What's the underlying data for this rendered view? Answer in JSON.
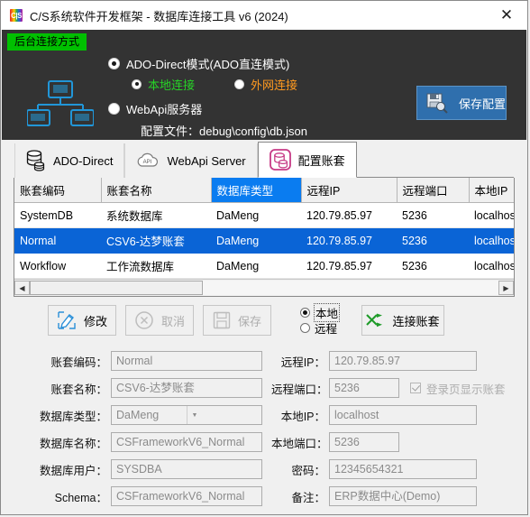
{
  "window": {
    "title": "C/S系统软件开发框架 - 数据库连接工具 v6 (2024)",
    "app_icon": "cis-logo-icon",
    "close_label": "✕"
  },
  "connection_panel": {
    "badge": "后台连接方式",
    "network_icon": "network-diagram-icon",
    "mode_primary": {
      "label": "ADO-Direct模式(ADO直连模式)",
      "selected": true
    },
    "sub_options": [
      {
        "label": "本地连接",
        "selected": true,
        "color": "#27d327"
      },
      {
        "label": "外网连接",
        "selected": false,
        "color": "#ff9a20"
      }
    ],
    "mode_webapi": {
      "label": "WebApi服务器",
      "selected": false
    },
    "config_file_line": "配置文件：debug\\config\\db.json",
    "save_button": {
      "label": "保存配置",
      "icon": "save-config-icon",
      "background": "#2f6fad"
    }
  },
  "tabs": [
    {
      "label": "ADO-Direct",
      "icon": "database-icon",
      "active": false
    },
    {
      "label": "WebApi Server",
      "icon": "api-cloud-icon",
      "active": false
    },
    {
      "label": "配置账套",
      "icon": "database-pink-icon",
      "active": true
    }
  ],
  "grid": {
    "columns": [
      {
        "label": "账套编码",
        "selected": false
      },
      {
        "label": "账套名称",
        "selected": false
      },
      {
        "label": "数据库类型",
        "selected": true
      },
      {
        "label": "远程IP",
        "selected": false
      },
      {
        "label": "远程端口",
        "selected": false
      },
      {
        "label": "本地IP",
        "selected": false
      }
    ],
    "rows": [
      {
        "cells": [
          "SystemDB",
          "系统数据库",
          "DaMeng",
          "120.79.85.97",
          "5236",
          "localhost"
        ],
        "selected": false
      },
      {
        "cells": [
          "Normal",
          "CSV6-达梦账套",
          "DaMeng",
          "120.79.85.97",
          "5236",
          "localhost"
        ],
        "selected": true
      },
      {
        "cells": [
          "Workflow",
          "工作流数据库",
          "DaMeng",
          "120.79.85.97",
          "5236",
          "localhost"
        ],
        "selected": false
      }
    ],
    "selection_color": "#0a64d6",
    "header_selection_color": "#0a7cf0",
    "scroll_left_arrow": "◀",
    "scroll_right_arrow": "▶"
  },
  "toolbar": {
    "edit_button": {
      "label": "修改",
      "icon": "edit-pencil-icon",
      "disabled": false
    },
    "cancel_button": {
      "label": "取消",
      "icon": "cancel-circle-icon",
      "disabled": true
    },
    "save_button": {
      "label": "保存",
      "icon": "floppy-save-icon",
      "disabled": true
    },
    "scope_options": [
      {
        "label": "本地",
        "selected": true
      },
      {
        "label": "远程",
        "selected": false
      }
    ],
    "connect_button": {
      "label": "连接账套",
      "icon": "shuffle-arrows-icon"
    }
  },
  "form": {
    "left": [
      {
        "label": "账套编码：",
        "value": "Normal",
        "type": "text"
      },
      {
        "label": "账套名称：",
        "value": "CSV6-达梦账套",
        "type": "text"
      },
      {
        "label": "数据库类型：",
        "value": "DaMeng",
        "type": "combo"
      },
      {
        "label": "数据库名称：",
        "value": "CSFrameworkV6_Normal",
        "type": "text"
      },
      {
        "label": "数据库用户：",
        "value": "SYSDBA",
        "type": "text"
      },
      {
        "label": "Schema：",
        "value": "CSFrameworkV6_Normal",
        "type": "text"
      }
    ],
    "right": [
      {
        "label": "远程IP：",
        "value": "120.79.85.97",
        "type": "text"
      },
      {
        "label": "远程端口：",
        "value": "5236",
        "type": "text"
      },
      {
        "label": "本地IP：",
        "value": "localhost",
        "type": "text"
      },
      {
        "label": "本地端口：",
        "value": "5236",
        "type": "text"
      },
      {
        "label": "密码：",
        "value": "12345654321",
        "type": "text"
      },
      {
        "label": "备注：",
        "value": "ERP数据中心(Demo)",
        "type": "text"
      }
    ],
    "show_accounts_checkbox": {
      "label": "登录页显示账套",
      "checked": true
    }
  }
}
